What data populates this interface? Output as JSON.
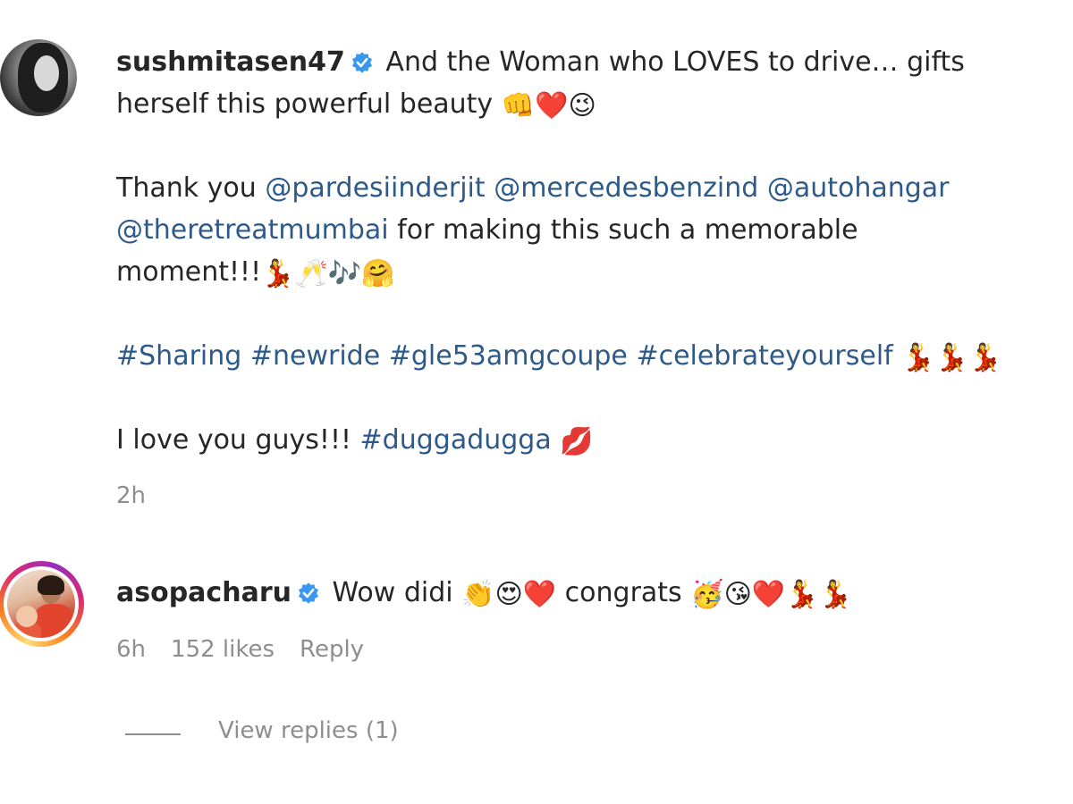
{
  "post": {
    "username": "sushmitasen47",
    "verified_icon": "verified-badge-icon",
    "line1_text": "And the Woman who LOVES to drive… gifts",
    "line2_text": "herself this powerful beauty",
    "line2_emojis": "👊❤️😉",
    "thanks_prefix": "Thank you ",
    "mention1": "@pardesiinderjit",
    "mention2": "@mercedesbenzind",
    "mention3": "@autohangar",
    "mention4": "@theretreatmumbai",
    "thanks_suffix": " for making this such a memorable",
    "moment_text": "moment!!!",
    "moment_emojis": "💃🥂🎶🤗",
    "hashtag1": "#Sharing",
    "hashtag2": "#newride",
    "hashtag3": "#gle53amgcoupe",
    "hashtag4": "#celebrateyourself",
    "hashtag_emojis": "💃💃💃",
    "love_text": "I love you guys!!! ",
    "hashtag5": "#duggadugga",
    "love_emoji": "💋",
    "time": "2h"
  },
  "comment": {
    "username": "asopacharu",
    "verified_icon": "verified-badge-icon",
    "text_prefix": "Wow didi ",
    "emojis1": "👏😍❤️",
    "text_mid": " congrats ",
    "emojis2": "🥳😘❤️💃💃",
    "time": "6h",
    "likes": "152 likes",
    "reply_label": "Reply",
    "view_replies_label": "View replies (1)"
  },
  "colors": {
    "link": "#2e5a8a",
    "meta": "#8e8e8e",
    "verified": "#3897f0"
  }
}
